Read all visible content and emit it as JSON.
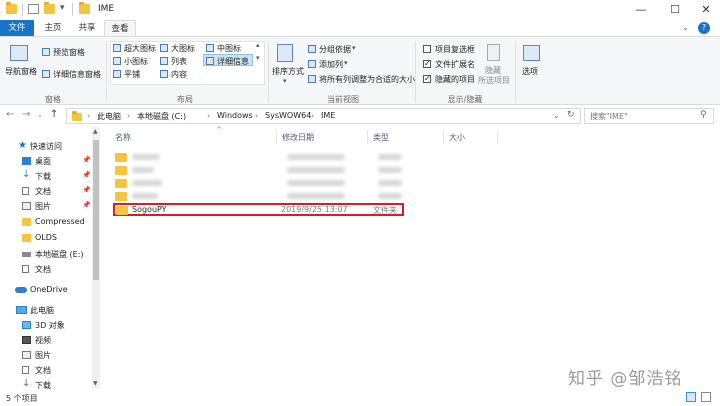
{
  "window": {
    "title": "IME",
    "controls": {
      "minimize": "—",
      "maximize": "☐",
      "close": "✕"
    }
  },
  "ribbon_tabs": {
    "file": "文件",
    "home": "主页",
    "share": "共享",
    "view": "查看"
  },
  "ribbon": {
    "panes": {
      "nav_pane": "导航窗格",
      "preview_pane": "预览窗格",
      "details_pane": "详细信息窗格",
      "group_label": "窗格"
    },
    "layout": {
      "extra_large_icons": "超大图标",
      "large_icons": "大图标",
      "medium_icons": "中图标",
      "small_icons": "小图标",
      "list": "列表",
      "details": "详细信息",
      "tiles": "平铺",
      "content": "内容",
      "group_label": "布局",
      "selected": "详细信息"
    },
    "current_view": {
      "sort_by": "排序方式",
      "group_by": "分组依据",
      "add_columns": "添加列",
      "size_all_columns": "将所有列调整为合适的大小",
      "group_label": "当前视图"
    },
    "show_hide": {
      "item_checkboxes": {
        "label": "项目复选框",
        "checked": false
      },
      "file_extensions": {
        "label": "文件扩展名",
        "checked": true
      },
      "hidden_items": {
        "label": "隐藏的项目",
        "checked": true
      },
      "hide_selected": "隐藏",
      "hide_selected_2": "所选项目",
      "group_label": "显示/隐藏"
    },
    "options": "选项"
  },
  "address": {
    "crumbs": [
      "此电脑",
      "本地磁盘 (C:)",
      "Windows",
      "SysWOW64",
      "IME"
    ],
    "search_placeholder": "搜索\"IME\""
  },
  "nav_pane": {
    "items": [
      {
        "label": "快速访问",
        "icon": "star-icon",
        "pinned": false
      },
      {
        "label": "桌面",
        "icon": "desktop-icon",
        "pinned": true
      },
      {
        "label": "下载",
        "icon": "download-icon",
        "pinned": true
      },
      {
        "label": "文档",
        "icon": "document-icon",
        "pinned": true
      },
      {
        "label": "图片",
        "icon": "picture-icon",
        "pinned": true
      },
      {
        "label": "Compressed",
        "icon": "folder-icon",
        "pinned": false
      },
      {
        "label": "OLDS",
        "icon": "folder-icon",
        "pinned": false
      },
      {
        "label": "本地磁盘 (E:)",
        "icon": "drive-icon",
        "pinned": false
      },
      {
        "label": "文档",
        "icon": "document-icon",
        "pinned": false
      },
      {
        "label": "OneDrive",
        "icon": "cloud-icon",
        "pinned": false
      },
      {
        "label": "此电脑",
        "icon": "computer-icon",
        "pinned": false
      },
      {
        "label": "3D 对象",
        "icon": "cube-icon",
        "pinned": false
      },
      {
        "label": "视频",
        "icon": "video-icon",
        "pinned": false
      },
      {
        "label": "图片",
        "icon": "picture-icon",
        "pinned": false
      },
      {
        "label": "文档",
        "icon": "document-icon",
        "pinned": false
      },
      {
        "label": "下载",
        "icon": "download-icon",
        "pinned": false
      }
    ]
  },
  "file_list": {
    "columns": {
      "name": "名称",
      "modified": "修改日期",
      "type": "类型",
      "size": "大小"
    },
    "highlighted_row": {
      "name": "SogouPY",
      "modified": "2019/9/25 13:07",
      "type": "文件夹",
      "size": ""
    }
  },
  "status": {
    "item_count": "5 个项目"
  },
  "watermark": "知乎 @邹浩铭",
  "colors": {
    "accent": "#1a73c8",
    "highlight_border": "#d21f2b",
    "folder": "#f5c542"
  }
}
